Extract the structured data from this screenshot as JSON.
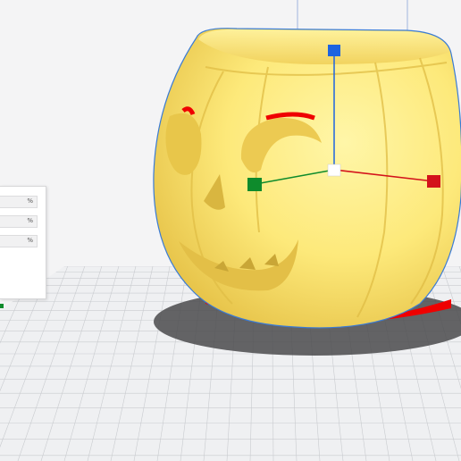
{
  "scale_panel": {
    "rows": [
      {
        "value": "",
        "unit": "%"
      },
      {
        "value": "",
        "unit": "%"
      },
      {
        "value": "",
        "unit": "%"
      }
    ]
  },
  "colors": {
    "model_fill": "#fde97a",
    "model_shadow": "#e9c94c",
    "overhang": "#f00000",
    "build_plate": "#eff0f2",
    "grid": "#c7c9cd",
    "x_axis": "#d3121b",
    "y_axis": "#0e8b2c",
    "z_axis": "#1e64e0",
    "selection_outline": "#3a7bd5"
  },
  "icons": {
    "move_handle_x": "red-cube-handle-icon",
    "move_handle_y": "green-cube-handle-icon",
    "move_handle_z": "blue-cube-handle-icon",
    "gizmo_center": "white-cube-center-icon"
  }
}
